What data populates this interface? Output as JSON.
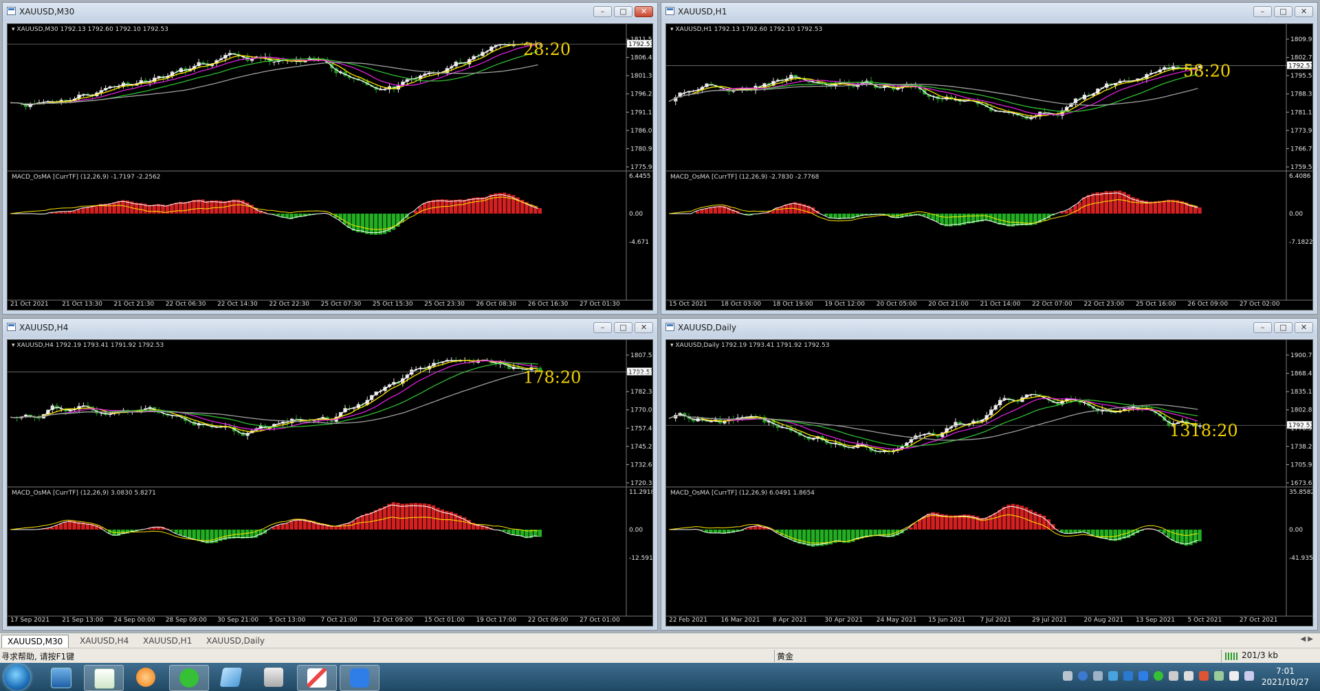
{
  "windows": [
    {
      "id": "m30",
      "title": "XAUUSD,M30",
      "info": "XAUUSD,M30  1792.13 1792.60 1792.10 1792.53",
      "price_labels": [
        "1811.50",
        "1806.40",
        "1801.30",
        "1796.20",
        "1791.10",
        "1786.00",
        "1780.90",
        "1775.95"
      ],
      "current_price": "1792.53",
      "countdown": "28:20",
      "macd_info": "MACD_OsMA [CurrTF] (12,26,9) -1.7197 -2.2562",
      "macd_labels": [
        "6.4455",
        "0.00",
        "-4.671"
      ],
      "time_labels": [
        "21 Oct 2021",
        "21 Oct 13:30",
        "21 Oct 21:30",
        "22 Oct 06:30",
        "22 Oct 14:30",
        "22 Oct 22:30",
        "25 Oct 07:30",
        "25 Oct 15:30",
        "25 Oct 23:30",
        "26 Oct 08:30",
        "26 Oct 16:30",
        "27 Oct 01:30"
      ]
    },
    {
      "id": "h1",
      "title": "XAUUSD,H1",
      "info": "XAUUSD,H1  1792.13 1792.60 1792.10 1792.53",
      "price_labels": [
        "1809.90",
        "1802.70",
        "1795.50",
        "1788.30",
        "1781.10",
        "1773.90",
        "1766.70",
        "1759.50"
      ],
      "current_price": "1792.53",
      "countdown": "58:20",
      "macd_info": "MACD_OsMA [CurrTF] (12,26,9) -2.7830 -2.7768",
      "macd_labels": [
        "6.4086",
        "0.00",
        "-7.1822"
      ],
      "time_labels": [
        "15 Oct 2021",
        "18 Oct 03:00",
        "18 Oct 19:00",
        "19 Oct 12:00",
        "20 Oct 05:00",
        "20 Oct 21:00",
        "21 Oct 14:00",
        "22 Oct 07:00",
        "22 Oct 23:00",
        "25 Oct 16:00",
        "26 Oct 09:00",
        "27 Oct 02:00"
      ]
    },
    {
      "id": "h4",
      "title": "XAUUSD,H4",
      "info": "XAUUSD,H4  1792.19 1793.41 1791.92 1792.53",
      "price_labels": [
        "1807.50",
        "1794.80",
        "1782.30",
        "1770.05",
        "1757.45",
        "1745.20",
        "1732.60",
        "1720.35"
      ],
      "current_price": "1792.53",
      "countdown": "178:20",
      "macd_info": "MACD_OsMA [CurrTF] (12,26,9) 3.0830 5.8271",
      "macd_labels": [
        "11.2918",
        "0.00",
        "-12.5919"
      ],
      "time_labels": [
        "17 Sep 2021",
        "21 Sep 13:00",
        "24 Sep 00:00",
        "28 Sep 09:00",
        "30 Sep 21:00",
        "5 Oct 13:00",
        "7 Oct 21:00",
        "12 Oct 09:00",
        "15 Oct 01:00",
        "19 Oct 17:00",
        "22 Oct 09:00",
        "27 Oct 01:00"
      ]
    },
    {
      "id": "d1",
      "title": "XAUUSD,Daily",
      "info": "XAUUSD,Daily  1792.19 1793.41 1791.92 1792.53",
      "price_labels": [
        "1900.70",
        "1868.40",
        "1835.15",
        "1802.85",
        "1770.55",
        "1738.25",
        "1705.95",
        "1673.65"
      ],
      "current_price": "1792.53",
      "countdown": "1318:20",
      "macd_info": "MACD_OsMA [CurrTF] (12,26,9) 6.0491 1.8654",
      "macd_labels": [
        "35.8582",
        "0.00",
        "-41.9351"
      ],
      "time_labels": [
        "22 Feb 2021",
        "16 Mar 2021",
        "8 Apr 2021",
        "30 Apr 2021",
        "24 May 2021",
        "15 Jun 2021",
        "7 Jul 2021",
        "29 Jul 2021",
        "20 Aug 2021",
        "13 Sep 2021",
        "5 Oct 2021",
        "27 Oct 2021"
      ]
    }
  ],
  "tabs": [
    "XAUUSD,M30",
    "XAUUSD,H4",
    "XAUUSD,H1",
    "XAUUSD,Daily"
  ],
  "active_tab": "XAUUSD,M30",
  "status": {
    "help": "寻求帮助, 请按F1键",
    "profile": "黄金",
    "traffic": "201/3 kb"
  },
  "clock": {
    "time": "7:01",
    "date": "2021/10/27"
  },
  "colors": {
    "chart_bg": "#000000",
    "bull": "#e3e3e3",
    "bear": "#1fa01f",
    "ma_white": "#ffffff",
    "ma_yellow": "#ffe600",
    "ma_magenta": "#e020e0",
    "ma_green": "#30c030",
    "ma_gray": "#a0a0a0",
    "osma_pos": "#d42020",
    "osma_neg": "#22b022",
    "countdown": "#f2d200"
  },
  "icons": [
    "start-orb-icon",
    "desktop-icon",
    "mt4-icon",
    "browser-icon",
    "wechat-icon",
    "notepad-icon",
    "app-icon",
    "paint-icon",
    "feishu-icon"
  ]
}
